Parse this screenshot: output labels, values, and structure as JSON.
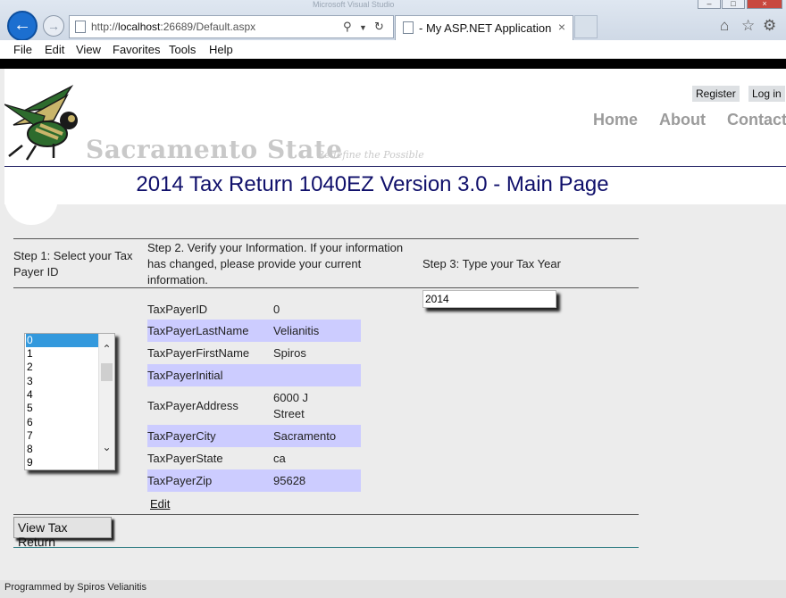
{
  "browser": {
    "window_title": "Microsoft Visual Studio",
    "url_prefix": "http://",
    "url_host": "localhost",
    "url_rest": ":26689/Default.aspx",
    "tab_title": "- My ASP.NET Application",
    "icons": [
      "back-icon",
      "forward-icon",
      "search-icon",
      "refresh-icon",
      "close-icon",
      "home-icon",
      "star-icon",
      "gear-icon"
    ],
    "accent": "#1c6fd0"
  },
  "menu": [
    "File",
    "Edit",
    "View",
    "Favorites",
    "Tools",
    "Help"
  ],
  "header": {
    "brand": "Sacramento State",
    "tagline": "Redefine the Possible",
    "register": "Register",
    "login": "Log in",
    "nav": [
      "Home",
      "About",
      "Contact"
    ]
  },
  "page_title": "2014 Tax Return 1040EZ Version 3.0 - Main Page",
  "steps": {
    "step1": "Step 1: Select your Tax Payer ID",
    "step2": "Step 2. Verify your Information. If your information has changed, please provide your current information.",
    "step3": "Step 3: Type your Tax Year"
  },
  "taxpayer_ids": [
    "0",
    "1",
    "2",
    "3",
    "4",
    "5",
    "6",
    "7",
    "8",
    "9"
  ],
  "selected_id": "0",
  "details": [
    {
      "label": "TaxPayerID",
      "value": "0"
    },
    {
      "label": "TaxPayerLastName",
      "value": "Velianitis"
    },
    {
      "label": "TaxPayerFirstName",
      "value": "Spiros"
    },
    {
      "label": "TaxPayerInitial",
      "value": ""
    },
    {
      "label": "TaxPayerAddress",
      "value": "6000 J Street"
    },
    {
      "label": "TaxPayerCity",
      "value": "Sacramento"
    },
    {
      "label": "TaxPayerState",
      "value": "ca"
    },
    {
      "label": "TaxPayerZip",
      "value": "95628"
    }
  ],
  "edit_label": "Edit",
  "tax_year": "2014",
  "view_button": "View Tax Return",
  "footer": "Programmed by Spiros Velianitis",
  "colors": {
    "title": "#10106b",
    "alt_row": "#ccccff",
    "selection": "#3399dd"
  }
}
